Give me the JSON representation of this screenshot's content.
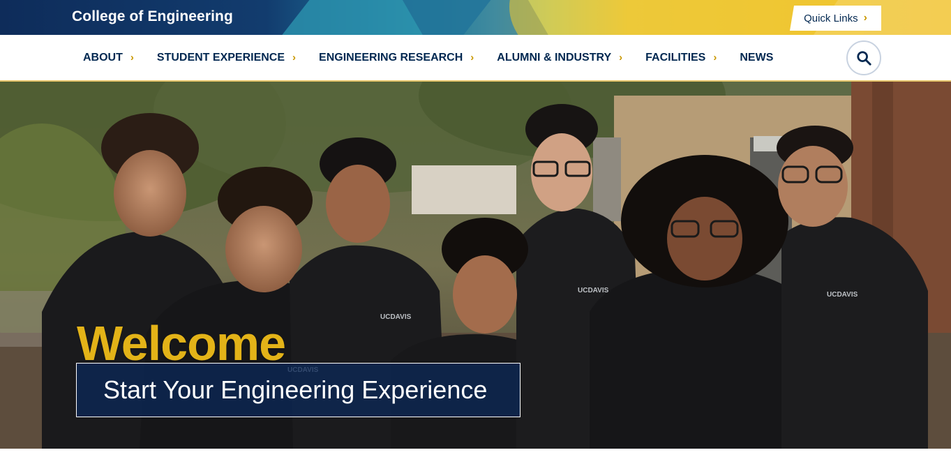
{
  "header": {
    "site_title": "College of Engineering",
    "quick_links_label": "Quick Links",
    "quick_links_icon": "chevron-right-icon"
  },
  "nav": {
    "items": [
      {
        "label": "ABOUT",
        "has_submenu": true
      },
      {
        "label": "STUDENT EXPERIENCE",
        "has_submenu": true
      },
      {
        "label": "ENGINEERING RESEARCH",
        "has_submenu": true
      },
      {
        "label": "ALUMNI & INDUSTRY",
        "has_submenu": true
      },
      {
        "label": "FACILITIES",
        "has_submenu": true
      },
      {
        "label": "NEWS",
        "has_submenu": false
      }
    ],
    "search_icon": "search-icon"
  },
  "hero": {
    "heading": "Welcome",
    "cta_label": "Start Your Engineering Experience",
    "shirt_logo_text": "UCDAVIS"
  },
  "colors": {
    "navy": "#022851",
    "gold": "#c99700",
    "welcome_gold": "#e3b318"
  }
}
